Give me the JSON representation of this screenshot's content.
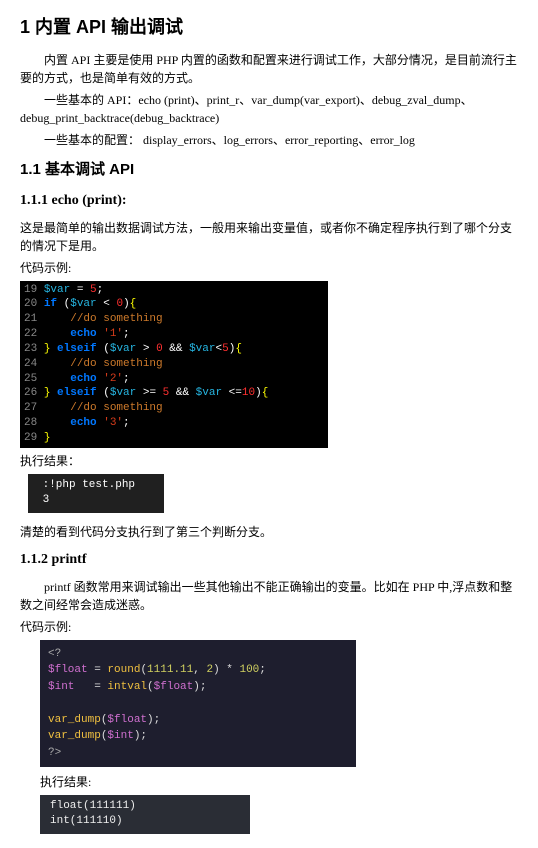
{
  "h1": "1  内置 API 输出调试",
  "p1": "内置 API 主要是使用 PHP 内置的函数和配置来进行调试工作，大部分情况，是目前流行主要的方式，也是简单有效的方式。",
  "p2": "一些基本的 API：echo (print)、print_r、var_dump(var_export)、debug_zval_dump、debug_print_backtrace(debug_backtrace)",
  "p3": "一些基本的配置：  display_errors、log_errors、error_reporting、error_log",
  "h2_1": "1.1  基本调试 API",
  "h3_1": "1.1.1  echo (print):",
  "sec1_p1": "这是最简单的输出数据调试方法，一般用来输出变量值，或者你不确定程序执行到了哪个分支的情况下是用。",
  "sec1_p2": "代码示例:",
  "code1": {
    "l19": {
      "ln": "19 ",
      "var": "$var",
      "rest1": " = ",
      "num": "5",
      "rest2": ";"
    },
    "l20": {
      "ln": "20 ",
      "kw": "if ",
      "op1": "(",
      "var": "$var",
      "op2": " < ",
      "num": "0",
      "op3": ")",
      "brk": "{"
    },
    "l21": {
      "ln": "21     ",
      "cmt": "//do something"
    },
    "l22": {
      "ln": "22     ",
      "kw": "echo ",
      "str": "'1'",
      "rest": ";"
    },
    "l23": {
      "ln": "23 ",
      "brk1": "}",
      "kw": " elseif ",
      "op1": "(",
      "var1": "$var",
      "op2": " > ",
      "num1": "0",
      "op3": " && ",
      "var2": "$var",
      "op4": "<",
      "num2": "5",
      "op5": ")",
      "brk2": "{"
    },
    "l24": {
      "ln": "24     ",
      "cmt": "//do something"
    },
    "l25": {
      "ln": "25     ",
      "kw": "echo ",
      "str": "'2'",
      "rest": ";"
    },
    "l26": {
      "ln": "26 ",
      "brk1": "}",
      "kw": " elseif ",
      "op1": "(",
      "var1": "$var",
      "op2": " >= ",
      "num1": "5",
      "op3": " && ",
      "var2": "$var",
      "op4": " <=",
      "num2": "10",
      "op5": ")",
      "brk2": "{"
    },
    "l27": {
      "ln": "27     ",
      "cmt": "//do something"
    },
    "l28": {
      "ln": "28     ",
      "kw": "echo ",
      "str": "'3'",
      "rest": ";"
    },
    "l29": {
      "ln": "29 ",
      "brk": "}"
    }
  },
  "sec1_p3": "执行结果：",
  "result1": " :!php test.php\n 3",
  "sec1_p4": "清楚的看到代码分支执行到了第三个判断分支。",
  "h3_2": "1.1.2  printf",
  "sec2_p1": "printf 函数常用来调试输出一些其他输出不能正确输出的变量。比如在 PHP 中,浮点数和整数之间经常会造成迷惑。",
  "sec2_p2": "代码示例:",
  "code2": {
    "open": "<?",
    "l1": {
      "var": "$float",
      "eq": " = ",
      "fn": "round",
      "op1": "(",
      "num1": "1111.11",
      "c": ", ",
      "num2": "2",
      "op2": ") * ",
      "num3": "100",
      "end": ";"
    },
    "l2": {
      "var": "$int",
      "eq": "   = ",
      "fn": "intval",
      "op1": "(",
      "var2": "$float",
      "op2": ")",
      "end": ";"
    },
    "l3": "",
    "l4": {
      "fn": "var_dump",
      "op1": "(",
      "var": "$float",
      "op2": ");"
    },
    "l5": {
      "fn": "var_dump",
      "op1": "(",
      "var": "$int",
      "op2": ");"
    },
    "close": "?>"
  },
  "sec2_p3": "执行结果:",
  "result2": "float(111111)\nint(111110)"
}
